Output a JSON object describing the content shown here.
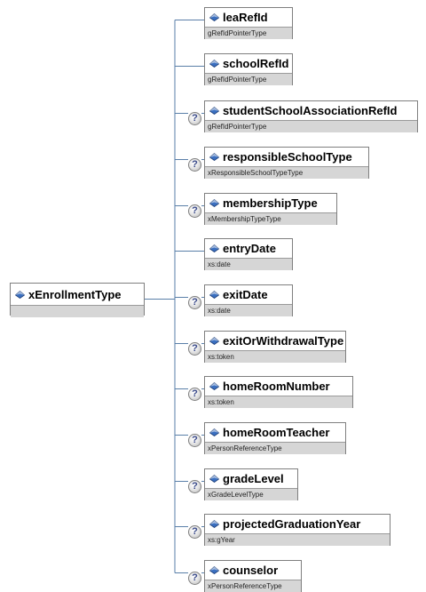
{
  "root": {
    "name": "xEnrollmentType",
    "optional": false
  },
  "children": [
    {
      "name": "leaRefId",
      "type": "gRefIdPointerType",
      "optional": false
    },
    {
      "name": "schoolRefId",
      "type": "gRefIdPointerType",
      "optional": false
    },
    {
      "name": "studentSchoolAssociationRefId",
      "type": "gRefIdPointerType",
      "optional": true
    },
    {
      "name": "responsibleSchoolType",
      "type": "xResponsibleSchoolTypeType",
      "optional": true
    },
    {
      "name": "membershipType",
      "type": "xMembershipTypeType",
      "optional": true
    },
    {
      "name": "entryDate",
      "type": "xs:date",
      "optional": false
    },
    {
      "name": "exitDate",
      "type": "xs:date",
      "optional": true
    },
    {
      "name": "exitOrWithdrawalType",
      "type": "xs:token",
      "optional": true
    },
    {
      "name": "homeRoomNumber",
      "type": "xs:token",
      "optional": true
    },
    {
      "name": "homeRoomTeacher",
      "type": "xPersonReferenceType",
      "optional": true
    },
    {
      "name": "gradeLevel",
      "type": "xGradeLevelType",
      "optional": true
    },
    {
      "name": "projectedGraduationYear",
      "type": "xs:gYear",
      "optional": true
    },
    {
      "name": "counselor",
      "type": "xPersonReferenceType",
      "optional": true
    }
  ],
  "optional_marker": "?",
  "colors": {
    "line": "#5a7fa8",
    "box_border": "#7f7f7f",
    "type_bar": "#d6d6d6",
    "diamond": "#3a6fc0"
  }
}
